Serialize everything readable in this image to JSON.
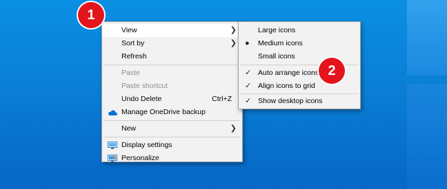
{
  "main_menu": {
    "items": [
      {
        "label": "View",
        "has_submenu": true
      },
      {
        "label": "Sort by",
        "has_submenu": true
      },
      {
        "label": "Refresh"
      },
      {
        "label": "Paste",
        "disabled": true
      },
      {
        "label": "Paste shortcut",
        "disabled": true
      },
      {
        "label": "Undo Delete",
        "shortcut": "Ctrl+Z"
      },
      {
        "label": "Manage OneDrive backup",
        "icon": "onedrive-icon"
      },
      {
        "label": "New",
        "has_submenu": true
      },
      {
        "label": "Display settings",
        "icon": "display-settings-icon"
      },
      {
        "label": "Personalize",
        "icon": "personalize-icon"
      }
    ]
  },
  "view_submenu": {
    "items": [
      {
        "label": "Large icons"
      },
      {
        "label": "Medium icons",
        "selected": true
      },
      {
        "label": "Small icons"
      },
      {
        "label": "Auto arrange icons",
        "checked": true
      },
      {
        "label": "Align icons to grid",
        "checked": true
      },
      {
        "label": "Show desktop icons",
        "checked": true
      }
    ]
  },
  "callouts": [
    "1",
    "2"
  ],
  "colors": {
    "callout": "#e4141c",
    "menu_bg": "#f2f2f2",
    "desktop": "#0a7fd6"
  }
}
